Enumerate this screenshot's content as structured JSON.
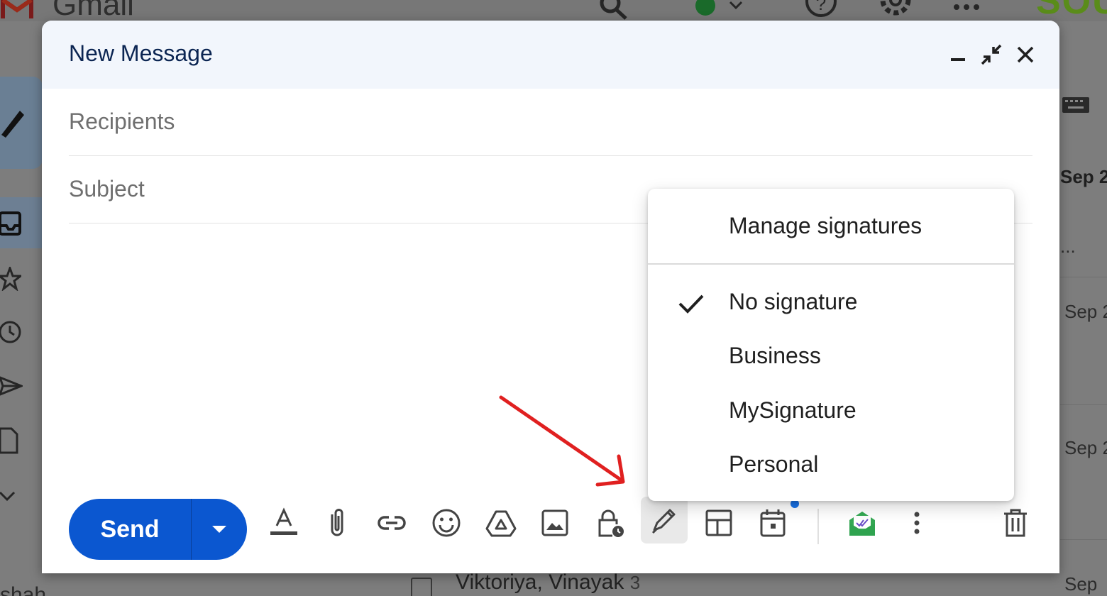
{
  "background": {
    "app_name": "Gmail",
    "brand_fragment": "SOU",
    "dates": [
      "Sep 2",
      "Sep 2",
      "Sep 2",
      "Sep 2",
      "Sep"
    ],
    "ellipsis": "...",
    "bottom_row": {
      "sender": "Viktoriya, Vinayak",
      "count": "3",
      "left_fragment": "shah"
    }
  },
  "compose": {
    "title": "New Message",
    "recipients_placeholder": "Recipients",
    "subject_placeholder": "Subject",
    "send_label": "Send"
  },
  "signature_menu": {
    "manage_label": "Manage signatures",
    "options": [
      {
        "label": "No signature",
        "checked": true
      },
      {
        "label": "Business",
        "checked": false
      },
      {
        "label": "MySignature",
        "checked": false
      },
      {
        "label": "Personal",
        "checked": false
      }
    ]
  },
  "icons": {
    "header": [
      "minimize-icon",
      "exit-fullscreen-icon",
      "close-icon"
    ],
    "toolbar": [
      "formatting-options-icon",
      "attach-file-icon",
      "insert-link-icon",
      "emoji-icon",
      "google-drive-icon",
      "insert-photo-icon",
      "confidential-mode-icon",
      "signature-icon",
      "layouts-icon",
      "schedule-event-icon",
      "mailtrack-icon",
      "more-options-icon",
      "discard-draft-icon"
    ]
  },
  "colors": {
    "send_button": "#0b57d0",
    "header_bg": "#f2f6fc",
    "annotation_arrow": "#e02020",
    "notification_dot": "#1a73e8"
  }
}
